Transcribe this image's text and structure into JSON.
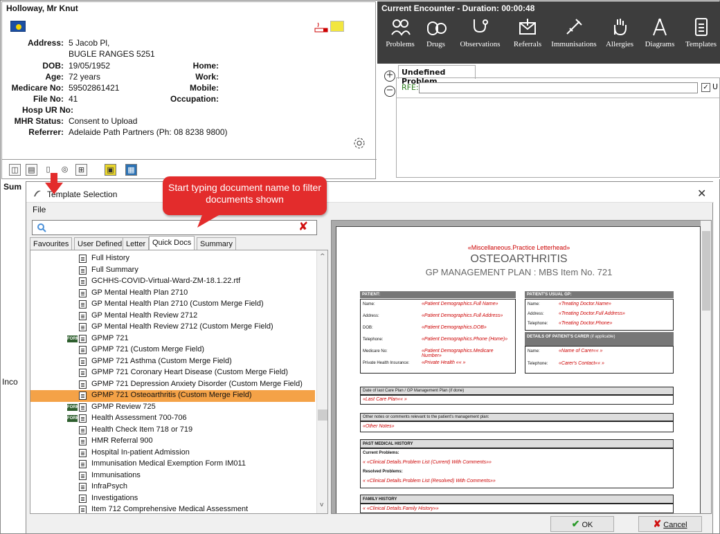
{
  "patient": {
    "name": "Holloway, Mr Knut",
    "address_label": "Address:",
    "address_line1": "5 Jacob Pl,",
    "address_line2": "BUGLE RANGES  5251",
    "dob_label": "DOB:",
    "dob": "19/05/1952",
    "age_label": "Age:",
    "age": "72 years",
    "medicare_label": "Medicare No:",
    "medicare": "59502861421",
    "file_label": "File No:",
    "file": "41",
    "hosp_label": "Hosp UR No:",
    "mhr_label": "MHR Status:",
    "mhr": "Consent to Upload",
    "referrer_label": "Referrer:",
    "referrer": "Adelaide Path Partners (Ph: 08 8238 9800)",
    "home_label": "Home:",
    "work_label": "Work:",
    "mobile_label": "Mobile:",
    "occupation_label": "Occupation:"
  },
  "side_label_summary": "Sum",
  "side_label_inc": "Inco",
  "encounter": {
    "title": "Current Encounter - Duration: 00:00:48",
    "toolbar": [
      "Problems",
      "Drugs",
      "Observations",
      "Referrals",
      "Immunisations",
      "Allergies",
      "Diagrams",
      "Templates"
    ],
    "problem_tab": "Undefined Problem",
    "rfe_label": "RFE:",
    "checkbox_partial": "U"
  },
  "dialog": {
    "title": "Template Selection",
    "file_menu": "File",
    "tabs": [
      "Favourites",
      "User Defined",
      "Letter",
      "Quick Docs",
      "Summary"
    ],
    "active_tab": "Quick Docs",
    "items": [
      {
        "label": "Full History",
        "form": false
      },
      {
        "label": "Full Summary",
        "form": false
      },
      {
        "label": "GCHHS-COVID-Virtual-Ward-ZM-18.1.22.rtf",
        "form": false
      },
      {
        "label": "GP Mental Health Plan 2710",
        "form": false
      },
      {
        "label": "GP Mental Health Plan 2710 (Custom Merge Field)",
        "form": false
      },
      {
        "label": "GP Mental Health Review 2712",
        "form": false
      },
      {
        "label": "GP Mental Health Review 2712 (Custom Merge Field)",
        "form": false
      },
      {
        "label": "GPMP 721",
        "form": true
      },
      {
        "label": "GPMP 721 (Custom Merge Field)",
        "form": false
      },
      {
        "label": "GPMP 721 Asthma (Custom Merge Field)",
        "form": false
      },
      {
        "label": "GPMP 721 Coronary Heart Disease (Custom Merge Field)",
        "form": false
      },
      {
        "label": "GPMP 721 Depression Anxiety Disorder (Custom Merge Field)",
        "form": false
      },
      {
        "label": "GPMP 721 Osteoarthritis (Custom Merge Field)",
        "form": false,
        "selected": true
      },
      {
        "label": "GPMP Review 725",
        "form": true
      },
      {
        "label": "Health Assessment 700-706",
        "form": true
      },
      {
        "label": "Health Check Item 718 or 719",
        "form": false
      },
      {
        "label": "HMR Referral 900",
        "form": false
      },
      {
        "label": "Hospital In-patient Admission",
        "form": false
      },
      {
        "label": "Immunisation Medical Exemption Form IM011",
        "form": false
      },
      {
        "label": "Immunisations",
        "form": false
      },
      {
        "label": "InfraPsych",
        "form": false
      },
      {
        "label": "Investigations",
        "form": false
      },
      {
        "label": "Item 712 Comprehensive Medical Assessment",
        "form": false
      }
    ],
    "form_badge": "FORM",
    "ok_label": "OK",
    "cancel_label": "Cancel"
  },
  "callout": "Start typing document name to filter documents shown",
  "preview": {
    "letterhead": "«Miscellaneous.Practice Letterhead»",
    "heading": "OSTEOARTHRITIS",
    "subheading": "GP MANAGEMENT PLAN  :  MBS Item No. 721",
    "patient_head": "PATIENT:",
    "gp_head": "PATIENT'S USUAL GP:",
    "carer_head": "DETAILS OF PATIENT'S CARER",
    "carer_note": "(if applicable)",
    "rows": [
      {
        "k": "Name:",
        "v": "«Patient Demographics.Full Name»"
      },
      {
        "k": "Address:",
        "v": "«Patient Demographics.Full Address»"
      },
      {
        "k": "DOB:",
        "v": "«Patient Demographics.DOB»"
      },
      {
        "k": "Telephone:",
        "v": "«Patient Demographics.Phone (Home)»"
      },
      {
        "k": "Medicare No:",
        "v": "«Patient Demographics.Medicare Number»"
      },
      {
        "k": "Private Health Insurance:",
        "v": "«Private Health «« »"
      }
    ],
    "gp_rows": [
      {
        "k": "Name:",
        "v": "«Treating Doctor.Name»"
      },
      {
        "k": "Address:",
        "v": "«Treating Doctor.Full Address»"
      },
      {
        "k": "Telephone:",
        "v": "«Treating Doctor.Phone»"
      }
    ],
    "carer_rows": [
      {
        "k": "Name:",
        "v": "«Name of Carer«« »"
      },
      {
        "k": "Telephone:",
        "v": "«Carer's Contact«« »"
      }
    ],
    "last_plan_label": "Date of last Care Plan / GP Management Plan  (if done)",
    "last_plan_value": "«Last Care Plan«« »",
    "notes_label": "Other notes or comments relevant to the patient's management plan:",
    "notes_value": "«Other Notes»",
    "pmh_head": "PAST MEDICAL HISTORY",
    "current_label": "Current Problems:",
    "current_value": "« «Clinical Details.Problem List (Current) With Comments»»",
    "resolved_label": "Resolved Problems:",
    "resolved_value": "« «Clinical Details.Problem List (Resolved) With Comments»»",
    "fh_head": "FAMILY HISTORY",
    "fh_value": "« «Clinical Details.Family History»»"
  },
  "colors": {
    "selected_row": "#f4a247",
    "callout": "#e32c2c",
    "encounter_bar": "#3d3d3d"
  }
}
